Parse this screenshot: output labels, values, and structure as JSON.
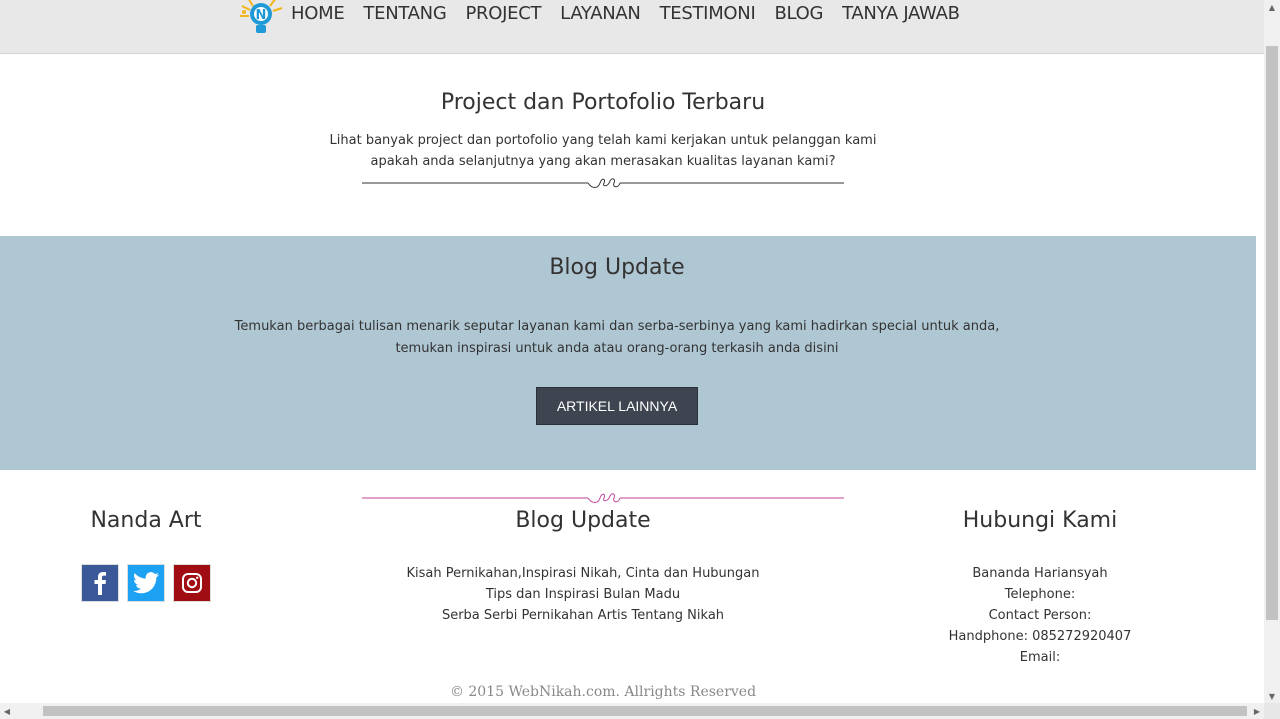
{
  "nav": {
    "items": [
      "HOME",
      "TENTANG",
      "PROJECT",
      "LAYANAN",
      "TESTIMONI",
      "BLOG",
      "TANYA JAWAB"
    ]
  },
  "project": {
    "title": "Project dan Portofolio Terbaru",
    "line1": "Lihat banyak project dan portofolio yang telah kami kerjakan untuk pelanggan kami",
    "line2": "apakah anda selanjutnya yang akan merasakan kualitas layanan kami?"
  },
  "blog": {
    "title": "Blog Update",
    "line1": "Temukan berbagai tulisan menarik seputar layanan kami dan serba-serbinya yang kami hadirkan special untuk anda,",
    "line2": "temukan inspirasi untuk anda atau orang-orang terkasih anda disini",
    "button": "ARTIKEL LAINNYA",
    "background": "#afc6d3"
  },
  "footer": {
    "left": {
      "title": "Nanda Art",
      "icons": [
        "facebook-icon",
        "twitter-icon",
        "instagram-icon"
      ]
    },
    "middle": {
      "title": "Blog Update",
      "links": [
        "Kisah Pernikahan,Inspirasi Nikah, Cinta dan Hubungan",
        "Tips dan Inspirasi Bulan Madu",
        "Serba Serbi Pernikahan Artis Tentang Nikah"
      ]
    },
    "right": {
      "title": "Hubungi Kami",
      "lines": [
        "Bananda Hariansyah",
        "Telephone:",
        "Contact Person:",
        "Handphone: 085272920407",
        "Email:"
      ]
    },
    "copyright": "© 2015 WebNikah.com. Allrights Reserved"
  },
  "colors": {
    "divider_project": "#333333",
    "divider_footer": "#c0459a",
    "facebook": "#3b5998",
    "twitter": "#1da1f2",
    "instagram": "#a00d12",
    "button": "#3e4550"
  }
}
